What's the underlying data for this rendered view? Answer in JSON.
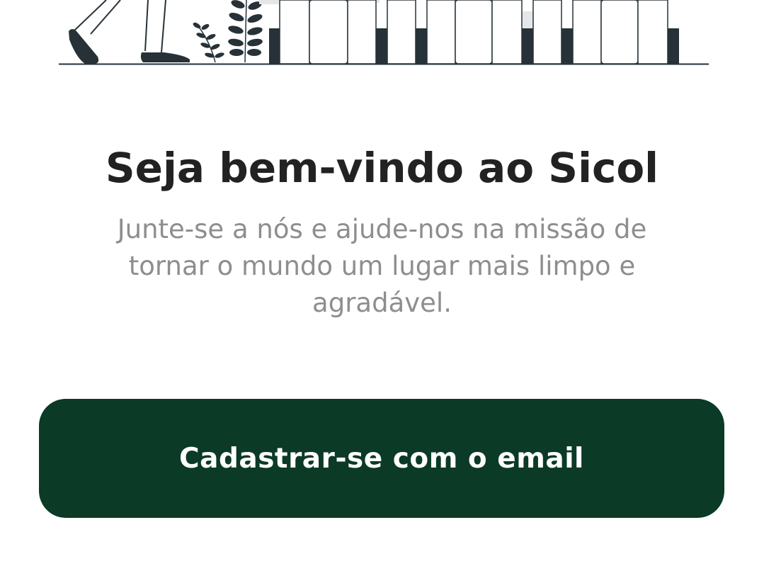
{
  "welcome": {
    "title": "Seja bem-vindo ao Sicol",
    "subtitle": "Junte-se a nós e ajude-nos na missão de tornar o mundo um lugar mais limpo e agradável."
  },
  "signup_button": {
    "label": "Cadastrar-se com o email"
  },
  "illustration": {
    "icon": "person-walking-plants-recycling-bins-illustration",
    "ink_color": "#263238",
    "accent_color": "#e6e6e6"
  },
  "colors": {
    "primary": "#0b3a27",
    "title": "#222222",
    "subtitle": "#8e8e8e",
    "background": "#ffffff"
  }
}
